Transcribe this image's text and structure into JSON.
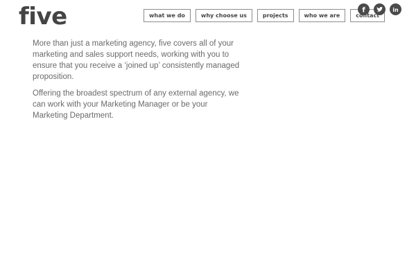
{
  "header": {
    "logo_text": "five"
  },
  "nav": {
    "items": [
      {
        "label": "what we do"
      },
      {
        "label": "why choose us"
      },
      {
        "label": "projects"
      },
      {
        "label": "who we are"
      },
      {
        "label": "contact"
      }
    ]
  },
  "social": {
    "icons": [
      "facebook-icon",
      "twitter-icon",
      "linkedin-icon"
    ],
    "color": "#4a4a4a"
  },
  "main": {
    "paragraphs": [
      "More than just a marketing agency, five covers all of your marketing and sales support needs, working with you to ensure that you receive a ‘joined up’ consistently managed proposition.",
      "Offering the broadest spectrum of any external agency, we can work with your Marketing Manager or be your Marketing Department."
    ]
  }
}
